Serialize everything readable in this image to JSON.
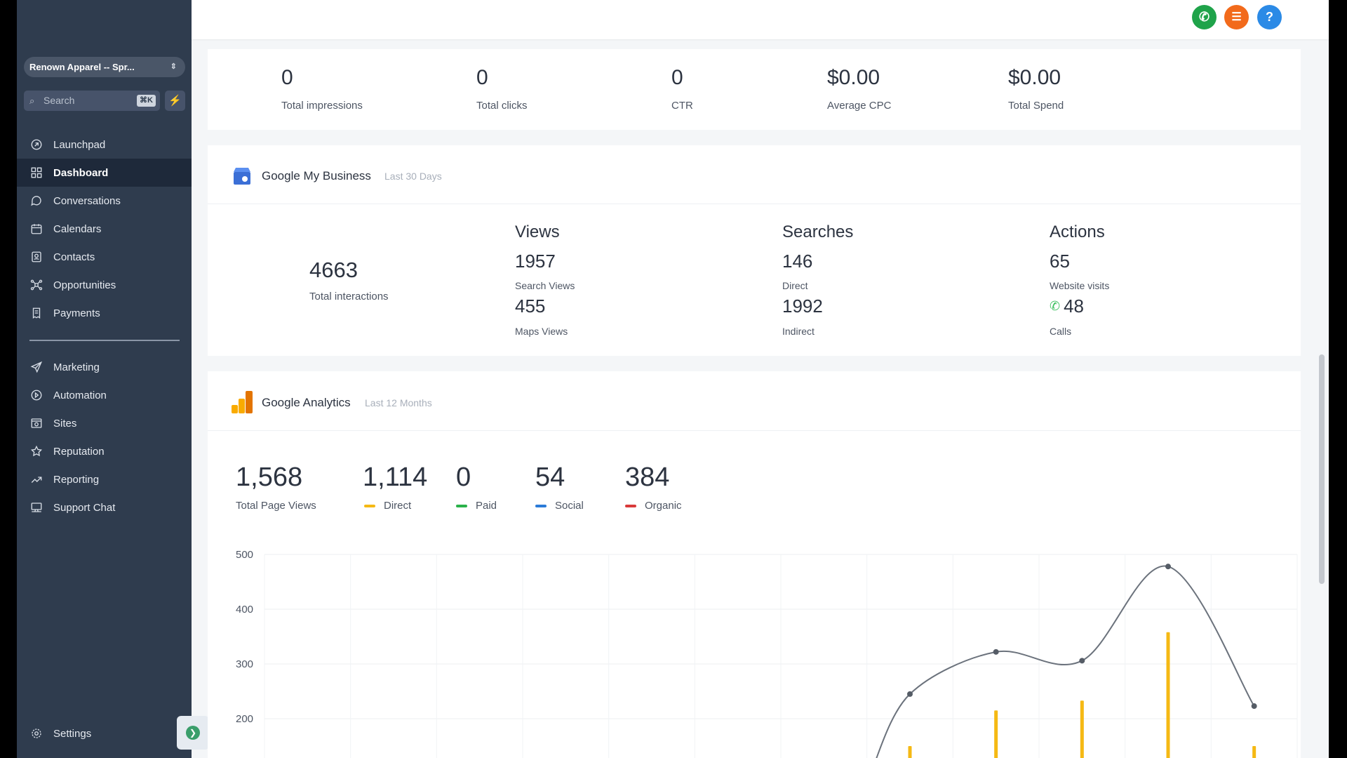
{
  "sidebar": {
    "account": "Renown Apparel -- Spr...",
    "search_placeholder": "Search",
    "search_shortcut": "⌘K",
    "items": [
      {
        "label": "Launchpad",
        "icon": "rocket-icon"
      },
      {
        "label": "Dashboard",
        "icon": "grid-icon",
        "active": true
      },
      {
        "label": "Conversations",
        "icon": "chat-icon"
      },
      {
        "label": "Calendars",
        "icon": "calendar-icon"
      },
      {
        "label": "Contacts",
        "icon": "contacts-icon"
      },
      {
        "label": "Opportunities",
        "icon": "network-icon"
      },
      {
        "label": "Payments",
        "icon": "receipt-icon"
      }
    ],
    "items2": [
      {
        "label": "Marketing",
        "icon": "send-icon"
      },
      {
        "label": "Automation",
        "icon": "automation-icon"
      },
      {
        "label": "Sites",
        "icon": "sites-icon"
      },
      {
        "label": "Reputation",
        "icon": "star-icon"
      },
      {
        "label": "Reporting",
        "icon": "trend-icon"
      },
      {
        "label": "Support Chat",
        "icon": "support-icon"
      }
    ],
    "settings_label": "Settings"
  },
  "header": {
    "colors": {
      "phone": "#1fa34a",
      "list": "#f26a1b",
      "help": "#2b8ae6"
    }
  },
  "ads": {
    "stats": [
      {
        "value": "0",
        "label": "Total impressions"
      },
      {
        "value": "0",
        "label": "Total clicks"
      },
      {
        "value": "0",
        "label": "CTR"
      },
      {
        "value": "$0.00",
        "label": "Average CPC"
      },
      {
        "value": "$0.00",
        "label": "Total Spend"
      }
    ]
  },
  "gmb": {
    "title": "Google My Business",
    "period": "Last 30 Days",
    "total_value": "4663",
    "total_label": "Total interactions",
    "views": {
      "heading": "Views",
      "v1": "1957",
      "l1": "Search Views",
      "v2": "455",
      "l2": "Maps Views"
    },
    "searches": {
      "heading": "Searches",
      "v1": "146",
      "l1": "Direct",
      "v2": "1992",
      "l2": "Indirect"
    },
    "actions": {
      "heading": "Actions",
      "v1": "65",
      "l1": "Website visits",
      "v2": "48",
      "l2": "Calls"
    }
  },
  "ga": {
    "title": "Google Analytics",
    "period": "Last 12 Months",
    "stats": [
      {
        "value": "1,568",
        "label": "Total Page Views",
        "color": ""
      },
      {
        "value": "1,114",
        "label": "Direct",
        "color": "#f5b914"
      },
      {
        "value": "0",
        "label": "Paid",
        "color": "#2ab24a"
      },
      {
        "value": "54",
        "label": "Social",
        "color": "#2b7bd8"
      },
      {
        "value": "384",
        "label": "Organic",
        "color": "#d93a3a"
      }
    ]
  },
  "chart_data": {
    "type": "line",
    "ylim": [
      200,
      500
    ],
    "yticks": [
      "500",
      "400",
      "300",
      "200"
    ],
    "columns": 12,
    "series": [
      {
        "values": [
          null,
          null,
          null,
          null,
          null,
          null,
          null,
          245,
          322,
          306,
          478,
          223
        ]
      }
    ],
    "bars": [
      {
        "values": [
          null,
          null,
          null,
          null,
          null,
          null,
          null,
          150,
          215,
          233,
          358,
          150
        ]
      }
    ]
  }
}
